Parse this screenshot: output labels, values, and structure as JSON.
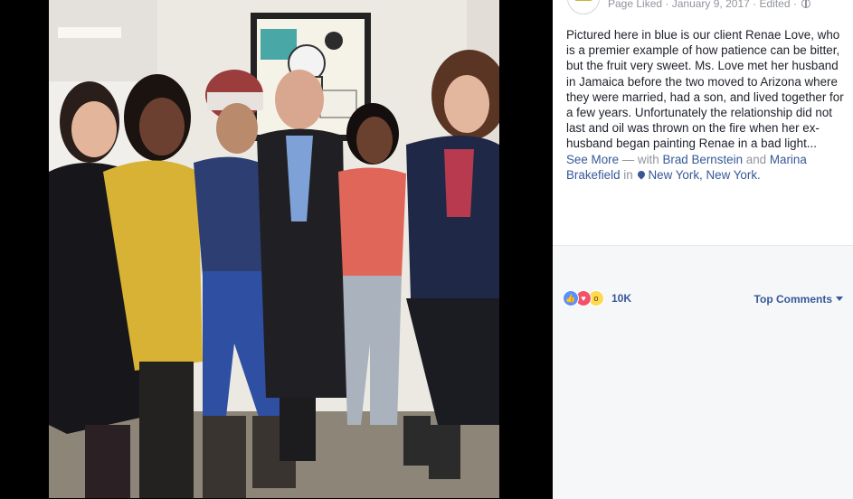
{
  "photo": {
    "description_icon": "group-photo"
  },
  "post": {
    "meta": {
      "status": "Page Liked",
      "date": "January 9, 2017",
      "edited": "Edited",
      "separator": "·"
    },
    "text": "Pictured here in blue is our client Renae Love, who is a premier example of how patience can be bitter, but the fruit very sweet. Ms. Love met her husband in Jamaica before the two moved to Arizona where they were married, had a son, and lived together for a few years. Unfortunately the relationship did not last and oil was thrown on the fire when her ex-husband began painting Renae in a bad light...",
    "see_more": "See More",
    "with_prefix": "— with",
    "tag_1": "Brad Bernstein",
    "and_word": "and",
    "tag_2": "Marina Brakefield",
    "in_word": "in",
    "location": "New York, New York."
  },
  "reactions": {
    "icons": [
      "like-icon",
      "love-icon",
      "wow-icon"
    ],
    "count": "10K"
  },
  "comments": {
    "sort_label": "Top Comments"
  },
  "colors": {
    "link": "#365899",
    "meta": "#90949c",
    "text": "#1d2129",
    "background": "#000000",
    "panel": "#ffffff",
    "comments_bg": "#f6f7f9"
  }
}
